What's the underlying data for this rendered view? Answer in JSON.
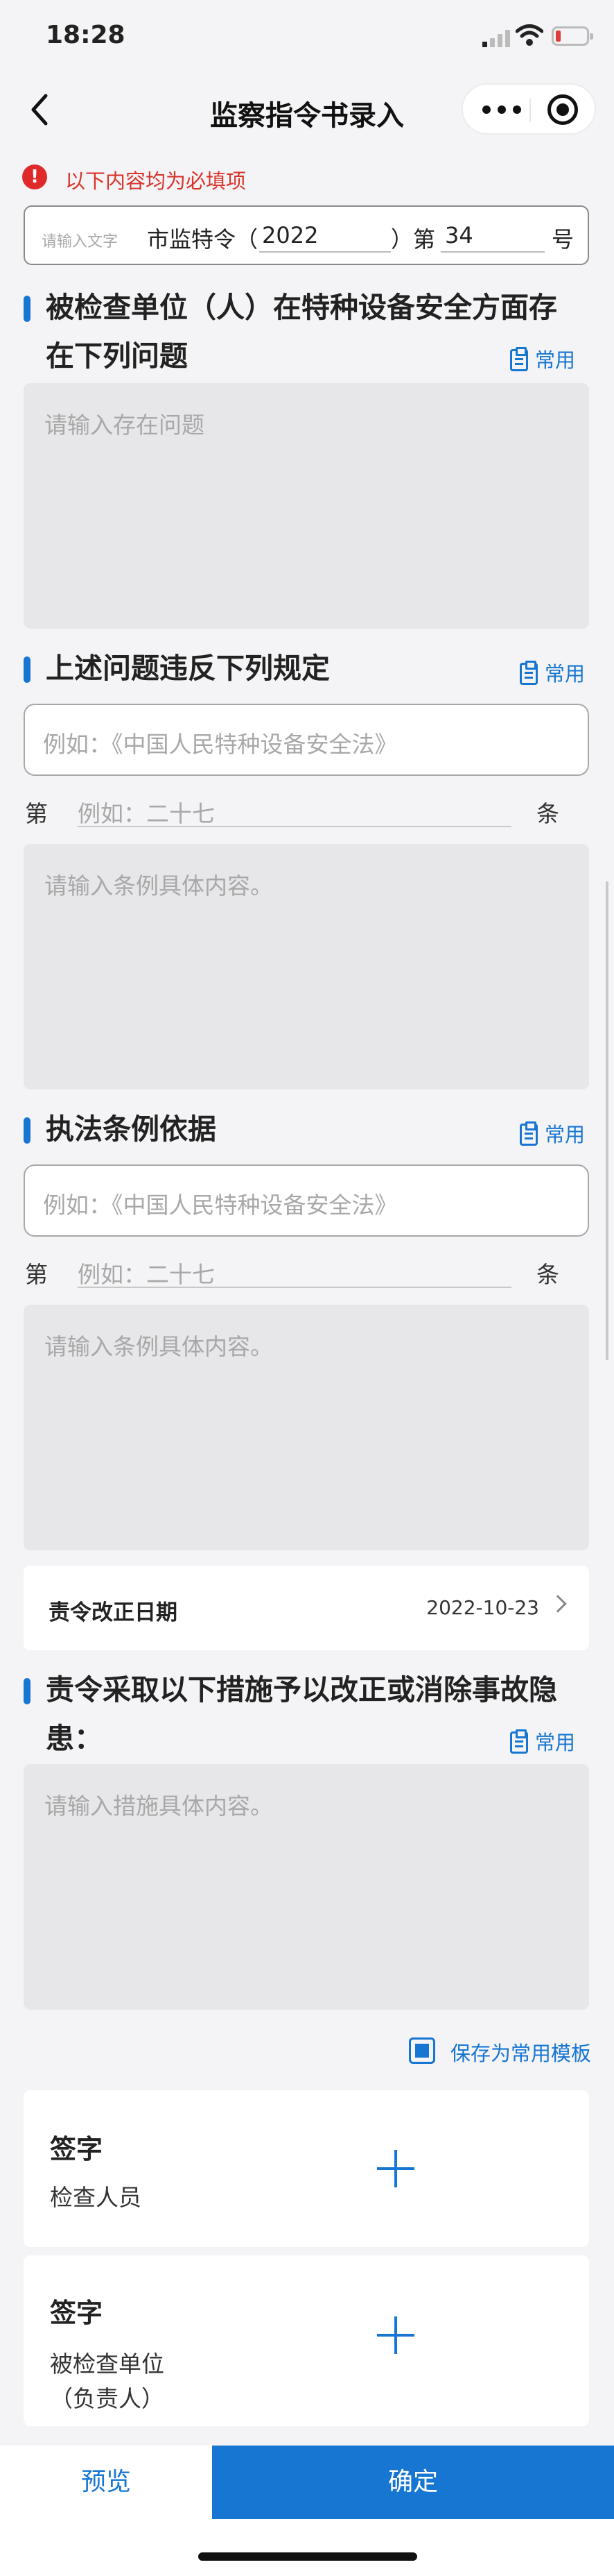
{
  "status": {
    "time": "18:28"
  },
  "nav": {
    "title": "监察指令书录入"
  },
  "notice": {
    "text": "以下内容均为必填项"
  },
  "doc_number": {
    "placeholder": "请输入文字",
    "prefix": "市监特令（",
    "year": "2022",
    "close_paren": "）第",
    "number": "34",
    "suffix": "号"
  },
  "sections": {
    "problems": {
      "title_line1": "被检查单位（人）在特种设备安全方面存",
      "title_line2": "在下列问题",
      "common_label": "常用",
      "placeholder": "请输入存在问题"
    },
    "violation": {
      "title": "上述问题违反下列规定",
      "common_label": "常用",
      "law_placeholder": "例如：《中国人民特种设备安全法》",
      "di": "第",
      "article_placeholder": "例如：二十七",
      "tiao": "条",
      "content_placeholder": "请输入条例具体内容。"
    },
    "basis": {
      "title": "执法条例依据",
      "common_label": "常用",
      "law_placeholder": "例如：《中国人民特种设备安全法》",
      "di": "第",
      "article_placeholder": "例如：二十七",
      "tiao": "条",
      "content_placeholder": "请输入条例具体内容。"
    },
    "deadline": {
      "label": "责令改正日期",
      "value": "2022-10-23"
    },
    "measures": {
      "title_line1": "责令采取以下措施予以改正或消除事故隐",
      "title_line2": "患：",
      "common_label": "常用",
      "placeholder": "请输入措施具体内容。"
    }
  },
  "save_template": {
    "label": "保存为常用模板",
    "checked": true
  },
  "signatures": [
    {
      "title": "签字",
      "subtitle_line1": "检查人员",
      "subtitle_line2": ""
    },
    {
      "title": "签字",
      "subtitle_line1": "被检查单位",
      "subtitle_line2": "（负责人）"
    }
  ],
  "footer": {
    "preview": "预览",
    "confirm": "确定"
  },
  "colors": {
    "accent": "#1676d2",
    "required": "#d9342b"
  }
}
